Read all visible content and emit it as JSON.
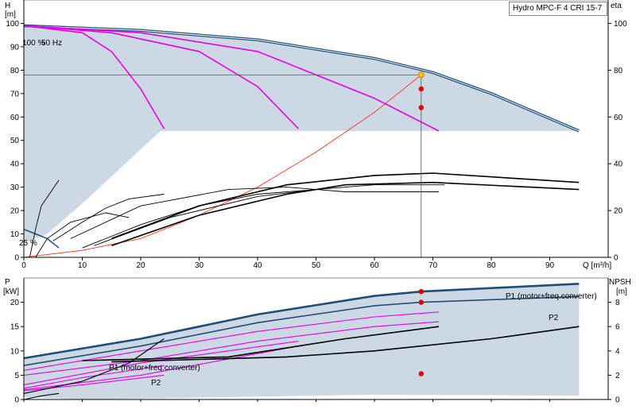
{
  "title": "Hydro MPC-F 4 CRI 15-7",
  "colors": {
    "area": "#ccd8e3",
    "envelope": "#1f4e79",
    "envelope_inner": "#ffffff",
    "magenta": "#e600e6",
    "system": "#ff2200",
    "operating_point": "#ffcc00",
    "marker": "#e00000",
    "grid": "#888888"
  },
  "chart_data": [
    {
      "type": "line",
      "panel": "head",
      "ylabel_left": [
        "H",
        "[m]"
      ],
      "ylabel_right": "eta",
      "xlabel": "Q [m³/h]",
      "xlim": [
        0,
        100
      ],
      "ylim": [
        0,
        110
      ],
      "x_ticks": [
        0,
        10,
        20,
        30,
        40,
        50,
        60,
        70,
        80,
        90
      ],
      "y_ticks": [
        0,
        10,
        20,
        30,
        40,
        50,
        60,
        70,
        80,
        90,
        100
      ],
      "eta_ticks": [
        0,
        20,
        40,
        60,
        80,
        100
      ],
      "annotations": [
        "100 %",
        "50 Hz",
        "25 %"
      ],
      "operating_point": {
        "q": 68,
        "h": 78
      },
      "series": [
        {
          "role": "max-envelope",
          "points": [
            [
              0,
              99
            ],
            [
              20,
              97
            ],
            [
              40,
              93
            ],
            [
              60,
              85
            ],
            [
              70,
              79
            ],
            [
              80,
              70
            ],
            [
              95,
              54
            ]
          ]
        },
        {
          "role": "speed",
          "points": [
            [
              0,
              99
            ],
            [
              10,
              96
            ],
            [
              15,
              88
            ],
            [
              20,
              72
            ],
            [
              24,
              55
            ]
          ]
        },
        {
          "role": "speed",
          "points": [
            [
              0,
              99
            ],
            [
              15,
              96
            ],
            [
              30,
              88
            ],
            [
              40,
              73
            ],
            [
              47,
              55
            ]
          ]
        },
        {
          "role": "speed",
          "points": [
            [
              0,
              99
            ],
            [
              20,
              96
            ],
            [
              40,
              88
            ],
            [
              60,
              68
            ],
            [
              71,
              54
            ]
          ]
        },
        {
          "role": "system",
          "points": [
            [
              0,
              0
            ],
            [
              10,
              3
            ],
            [
              20,
              8
            ],
            [
              30,
              18
            ],
            [
              40,
              30
            ],
            [
              50,
              45
            ],
            [
              60,
              62
            ],
            [
              68,
              78
            ]
          ]
        }
      ],
      "efficiency_curves": [
        [
          [
            1,
            0
          ],
          [
            2,
            12
          ],
          [
            3,
            22
          ],
          [
            6,
            33
          ]
        ],
        [
          [
            2,
            0
          ],
          [
            4,
            8
          ],
          [
            8,
            15
          ],
          [
            14,
            19
          ],
          [
            18,
            17
          ]
        ],
        [
          [
            5,
            7
          ],
          [
            10,
            15
          ],
          [
            14,
            21
          ],
          [
            18,
            25
          ],
          [
            24,
            27
          ]
        ],
        [
          [
            10,
            4
          ],
          [
            20,
            14
          ],
          [
            30,
            22
          ],
          [
            40,
            27
          ],
          [
            50,
            29
          ]
        ],
        [
          [
            8,
            8
          ],
          [
            20,
            22
          ],
          [
            35,
            29
          ],
          [
            45,
            30
          ],
          [
            55,
            28
          ],
          [
            71,
            28
          ]
        ],
        [
          [
            12,
            5
          ],
          [
            25,
            17
          ],
          [
            40,
            26
          ],
          [
            50,
            29
          ],
          [
            60,
            31
          ],
          [
            72,
            31
          ]
        ],
        [
          [
            15,
            8
          ],
          [
            30,
            22
          ],
          [
            45,
            31
          ],
          [
            60,
            35
          ],
          [
            70,
            36
          ],
          [
            95,
            32
          ]
        ],
        [
          [
            15,
            5
          ],
          [
            30,
            18
          ],
          [
            45,
            27
          ],
          [
            55,
            31
          ],
          [
            70,
            32
          ],
          [
            95,
            29
          ]
        ]
      ],
      "eta_markers": [
        {
          "q": 68,
          "eta": 72
        },
        {
          "q": 68,
          "eta": 64
        }
      ]
    },
    {
      "type": "line",
      "panel": "power",
      "ylabel_left": [
        "P",
        "[kW]"
      ],
      "ylabel_right": [
        "NPSH",
        "[m]"
      ],
      "xlim": [
        0,
        100
      ],
      "ylim": [
        0,
        25
      ],
      "y_ticks": [
        0,
        5,
        10,
        15,
        20
      ],
      "npsh_ticks": [
        0,
        2,
        4,
        6,
        8
      ],
      "labels": [
        "P1 (motor+freq.converter)",
        "P2",
        "P1 (motor+freq.converter)",
        "P2"
      ],
      "series": [
        {
          "role": "P1-max",
          "points": [
            [
              0,
              8.5
            ],
            [
              20,
              12.5
            ],
            [
              40,
              17.5
            ],
            [
              60,
              21.3
            ],
            [
              68,
              22.2
            ],
            [
              95,
              23.8
            ]
          ]
        },
        {
          "role": "P2-max",
          "points": [
            [
              0,
              7
            ],
            [
              20,
              11
            ],
            [
              40,
              15.8
            ],
            [
              60,
              19.3
            ],
            [
              68,
              20.0
            ],
            [
              95,
              21.2
            ]
          ]
        },
        {
          "role": "P1-speed",
          "points": [
            [
              0,
              6
            ],
            [
              20,
              10
            ],
            [
              40,
              14
            ],
            [
              60,
              17
            ],
            [
              71,
              18
            ]
          ]
        },
        {
          "role": "P2-speed",
          "points": [
            [
              0,
              5
            ],
            [
              20,
              8
            ],
            [
              40,
              12
            ],
            [
              60,
              15
            ],
            [
              71,
              16
            ]
          ]
        },
        {
          "role": "P1-speed",
          "points": [
            [
              0,
              3
            ],
            [
              20,
              7.5
            ],
            [
              47,
              12
            ]
          ]
        },
        {
          "role": "P2-speed",
          "points": [
            [
              0,
              2
            ],
            [
              20,
              5
            ],
            [
              47,
              11
            ]
          ]
        },
        {
          "role": "P1-speed",
          "points": [
            [
              0,
              2.3
            ],
            [
              10,
              4.5
            ],
            [
              24,
              7
            ]
          ]
        },
        {
          "role": "P2-speed",
          "points": [
            [
              0,
              1.8
            ],
            [
              10,
              3
            ],
            [
              24,
              5
            ]
          ]
        }
      ],
      "npsh_curves": [
        [
          [
            0,
            0
          ],
          [
            3,
            0.3
          ],
          [
            6,
            0.5
          ]
        ],
        [
          [
            0,
            0.5
          ],
          [
            10,
            1.5
          ],
          [
            18,
            3
          ],
          [
            24,
            5
          ]
        ],
        [
          [
            10,
            3.2
          ],
          [
            35,
            3.5
          ],
          [
            55,
            5
          ],
          [
            71,
            6
          ]
        ],
        [
          [
            15,
            3.1
          ],
          [
            45,
            3.5
          ],
          [
            60,
            4
          ],
          [
            80,
            5
          ],
          [
            95,
            6
          ]
        ]
      ],
      "markers": [
        {
          "q": 68,
          "p": 22.2
        },
        {
          "q": 68,
          "p": 20.0
        },
        {
          "q": 68,
          "p": 5.3
        }
      ]
    }
  ]
}
